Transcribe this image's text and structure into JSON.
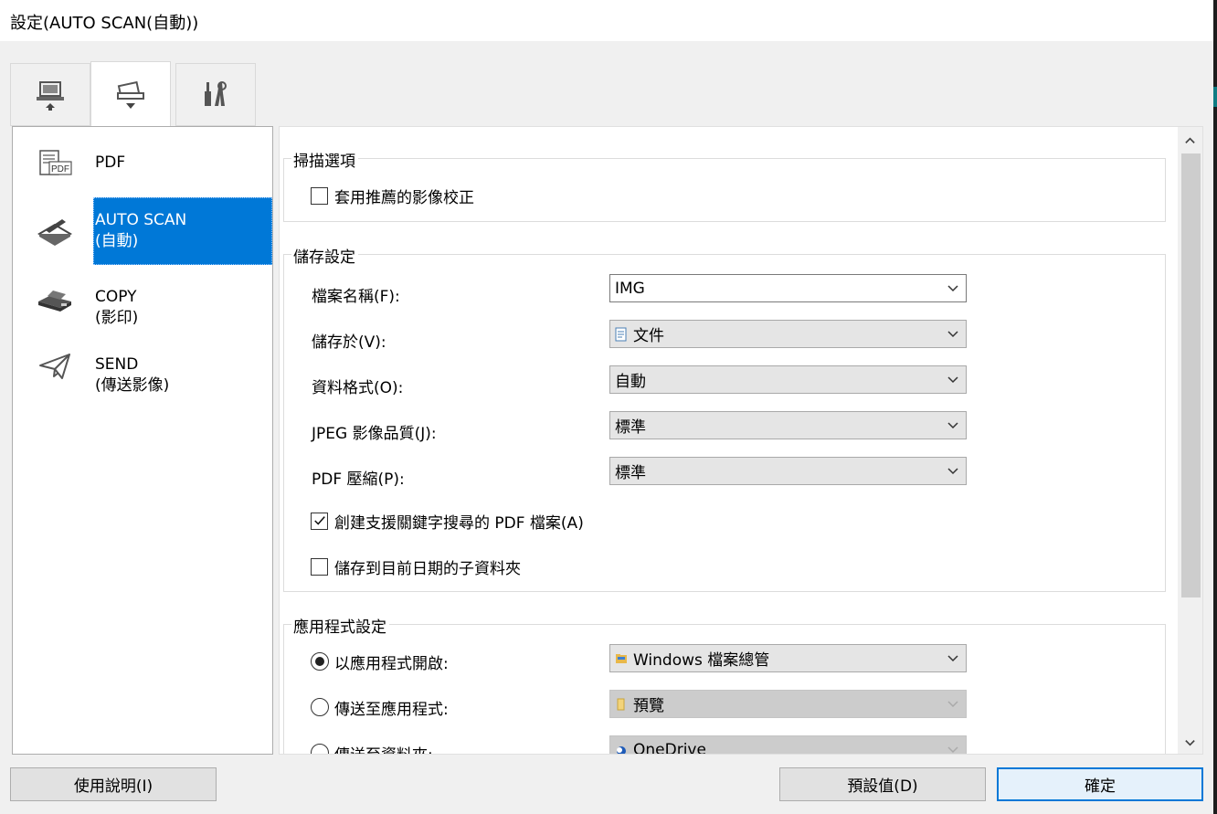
{
  "window": {
    "title": "設定(AUTO SCAN(自動))"
  },
  "tabs": [
    {
      "name": "scan-from-computer",
      "icon": "computer-upload-icon"
    },
    {
      "name": "scan-from-device",
      "icon": "scanner-download-icon"
    },
    {
      "name": "tools",
      "icon": "tools-icon"
    }
  ],
  "sidebar": {
    "items": [
      {
        "label1": "PDF",
        "label2": "",
        "icon": "pdf-icon"
      },
      {
        "label1": "AUTO SCAN",
        "label2": "(自動)",
        "icon": "scanner-icon",
        "selected": true
      },
      {
        "label1": "COPY",
        "label2": "(影印)",
        "icon": "printer-icon"
      },
      {
        "label1": "SEND",
        "label2": "(傳送影像)",
        "icon": "paper-plane-icon"
      }
    ]
  },
  "scan_options": {
    "title": "掃描選項",
    "apply_recommended": {
      "label": "套用推薦的影像校正",
      "checked": false
    }
  },
  "save_settings": {
    "title": "儲存設定",
    "file_name": {
      "label": "檔案名稱(F):",
      "value": "IMG"
    },
    "save_in": {
      "label": "儲存於(V):",
      "value": "文件"
    },
    "data_format": {
      "label": "資料格式(O):",
      "value": "自動"
    },
    "jpeg_quality": {
      "label": "JPEG 影像品質(J):",
      "value": "標準"
    },
    "pdf_compression": {
      "label": "PDF 壓縮(P):",
      "value": "標準"
    },
    "keyword_pdf": {
      "label": "創建支援關鍵字搜尋的 PDF 檔案(A)",
      "checked": true
    },
    "date_subfolder": {
      "label": "儲存到目前日期的子資料夾",
      "checked": false
    }
  },
  "app_settings": {
    "title": "應用程式設定",
    "open_with": {
      "label": "以應用程式開啟:",
      "value": "Windows 檔案總管",
      "selected": true
    },
    "send_to_app": {
      "label": "傳送至應用程式:",
      "value": "預覽"
    },
    "send_to_folder": {
      "label": "傳送至資料夾:",
      "value": "OneDrive"
    }
  },
  "buttons": {
    "help": "使用說明(I)",
    "defaults": "預設值(D)",
    "ok": "確定"
  },
  "colors": {
    "accent": "#0078d7",
    "window_bg": "#f0f0f0"
  }
}
